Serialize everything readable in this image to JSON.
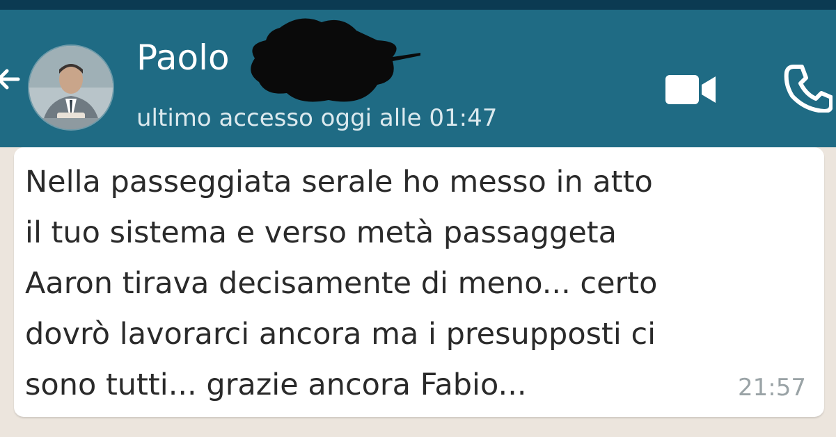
{
  "status_bar": {
    "color": "#0b3a52"
  },
  "header": {
    "background": "#1f6b84",
    "back_icon": "arrow-back-icon",
    "avatar_icon": "contact-avatar",
    "contact_name": "Paolo",
    "last_seen": "ultimo accesso oggi alle 01:47",
    "video_call_icon": "video-camera-icon",
    "voice_call_icon": "phone-icon"
  },
  "message": {
    "direction": "incoming",
    "text": "Nella passeggiata serale ho messo in atto\nil tuo sistema e verso metà passaggeta\nAaron tirava decisamente di meno... certo\ndovrò lavorarci ancora ma i presupposti ci\nsono tutti... grazie ancora Fabio...",
    "time": "21:57"
  },
  "chat_background": "#ece5dd"
}
